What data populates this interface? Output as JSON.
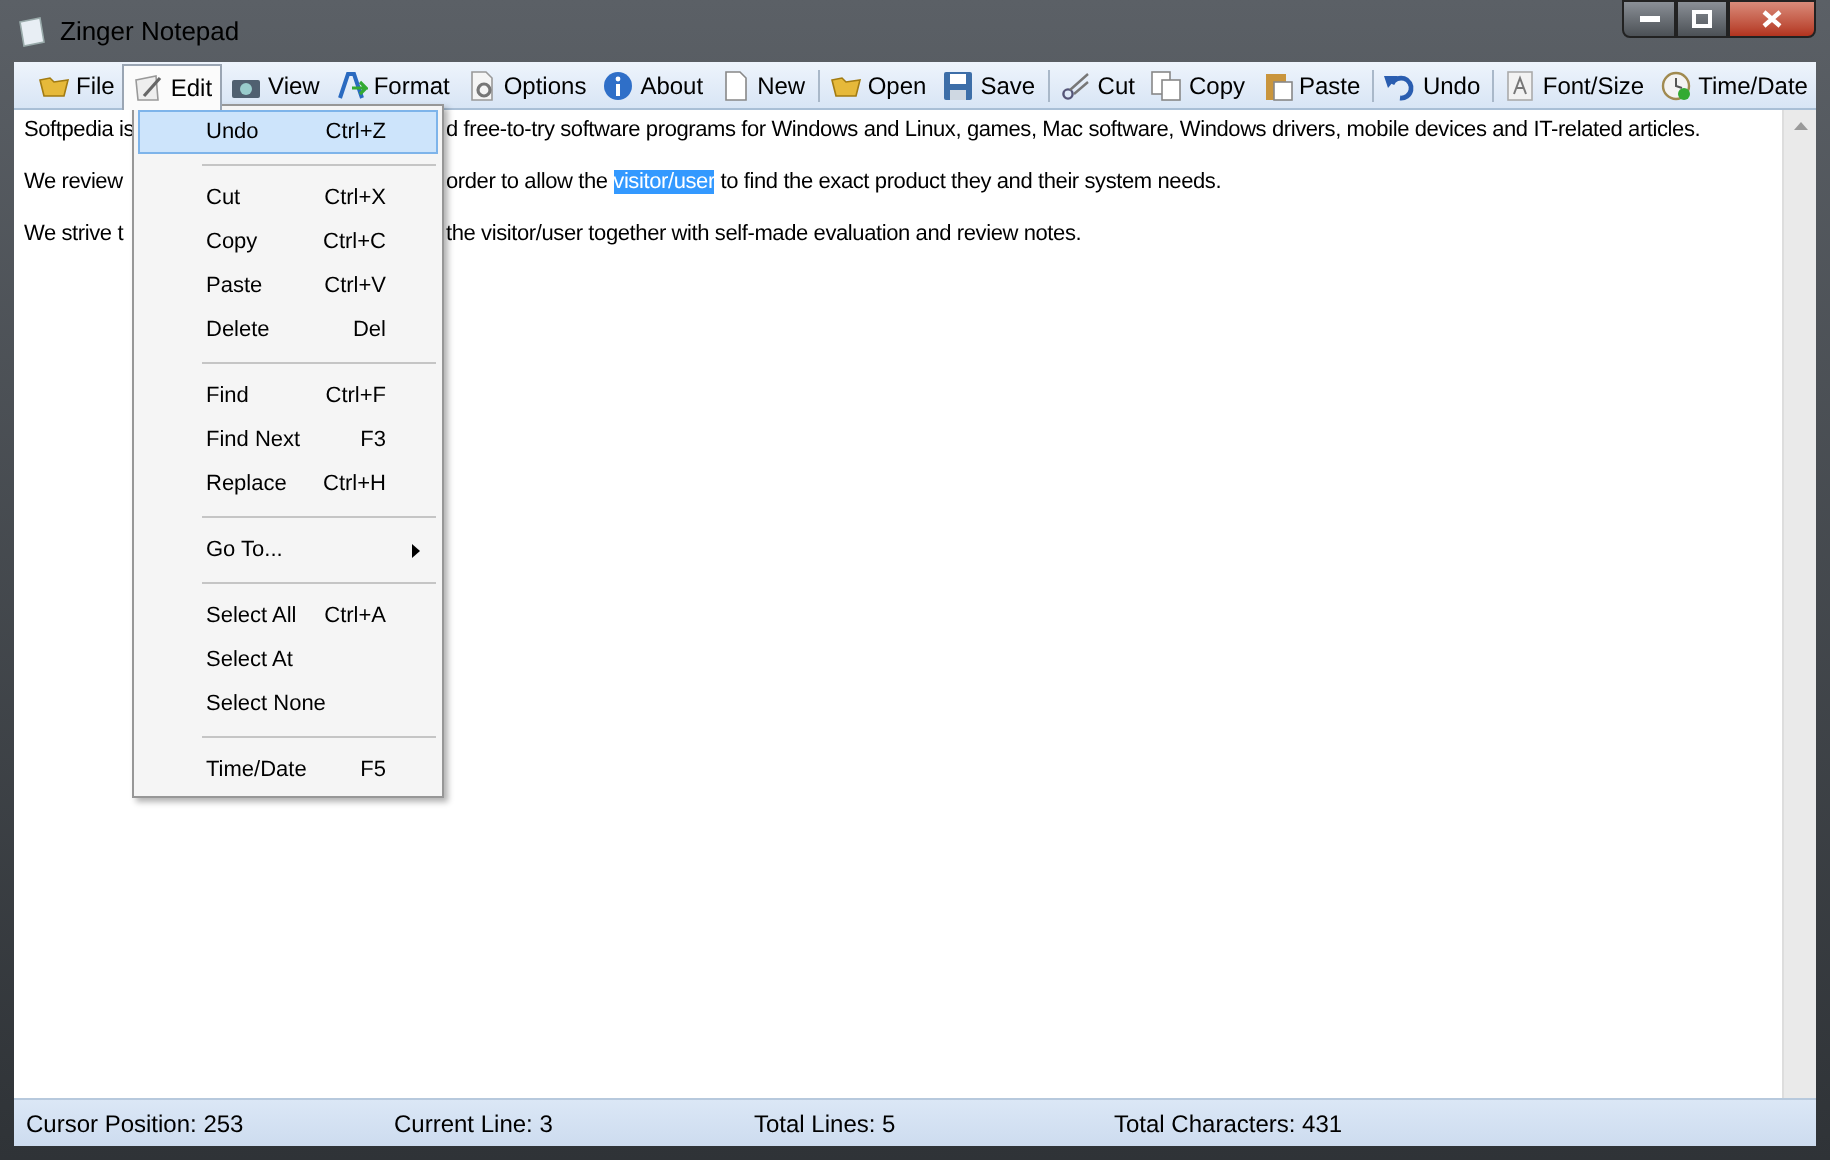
{
  "window": {
    "title": "Zinger Notepad"
  },
  "toolbar": [
    [
      {
        "label": "File",
        "selected": false
      },
      {
        "label": "Edit",
        "selected": true
      },
      {
        "label": "View",
        "selected": false
      },
      {
        "label": "Format",
        "selected": false
      },
      {
        "label": "Options",
        "selected": false
      },
      {
        "label": "About",
        "selected": false
      },
      {
        "label": "New",
        "selected": false
      }
    ],
    [
      {
        "label": "Open",
        "selected": false
      },
      {
        "label": "Save",
        "selected": false
      }
    ],
    [
      {
        "label": "Cut",
        "selected": false
      },
      {
        "label": "Copy",
        "selected": false
      },
      {
        "label": "Paste",
        "selected": false
      }
    ],
    [
      {
        "label": "Undo",
        "selected": false
      }
    ],
    [
      {
        "label": "Font/Size",
        "selected": false
      },
      {
        "label": "Time/Date",
        "selected": false
      }
    ]
  ],
  "document": {
    "lines": [
      {
        "left": "Softpedia is",
        "right": [
          {
            "text": "d free-to-try software programs for Windows and Linux, games, Mac software, Windows drivers, mobile devices and IT-related articles.",
            "selected": false
          }
        ]
      },
      {
        "left": "We review",
        "right": [
          {
            "text": "order to allow the ",
            "selected": false
          },
          {
            "text": "visitor/user",
            "selected": true
          },
          {
            "text": " to find the exact product they and their system needs.",
            "selected": false
          }
        ]
      },
      {
        "left": "We strive t",
        "right": [
          {
            "text": "the visitor/user together with self-made evaluation and review notes.",
            "selected": false
          }
        ]
      }
    ]
  },
  "edit_menu": [
    {
      "kind": "item",
      "label": "Undo",
      "shortcut": "Ctrl+Z",
      "selected": true
    },
    {
      "kind": "separator"
    },
    {
      "kind": "item",
      "label": "Cut",
      "shortcut": "Ctrl+X",
      "selected": false
    },
    {
      "kind": "item",
      "label": "Copy",
      "shortcut": "Ctrl+C",
      "selected": false
    },
    {
      "kind": "item",
      "label": "Paste",
      "shortcut": "Ctrl+V",
      "selected": false
    },
    {
      "kind": "item",
      "label": "Delete",
      "shortcut": "Del",
      "selected": false
    },
    {
      "kind": "separator"
    },
    {
      "kind": "item",
      "label": "Find",
      "shortcut": "Ctrl+F",
      "selected": false
    },
    {
      "kind": "item",
      "label": "Find Next",
      "shortcut": "F3",
      "selected": false
    },
    {
      "kind": "item",
      "label": "Replace",
      "shortcut": "Ctrl+H",
      "selected": false
    },
    {
      "kind": "separator"
    },
    {
      "kind": "submenu",
      "label": "Go To...",
      "selected": false
    },
    {
      "kind": "separator"
    },
    {
      "kind": "item",
      "label": "Select All",
      "shortcut": "Ctrl+A",
      "selected": false
    },
    {
      "kind": "item",
      "label": "Select At",
      "selected": false
    },
    {
      "kind": "item",
      "label": "Select None",
      "selected": false
    },
    {
      "kind": "separator"
    },
    {
      "kind": "item",
      "label": "Time/Date",
      "shortcut": "F5",
      "selected": false
    }
  ],
  "status_bar": [
    "Cursor Position: 253",
    "Current Line: 3",
    "Total Lines: 5",
    "Total Characters: 431"
  ]
}
